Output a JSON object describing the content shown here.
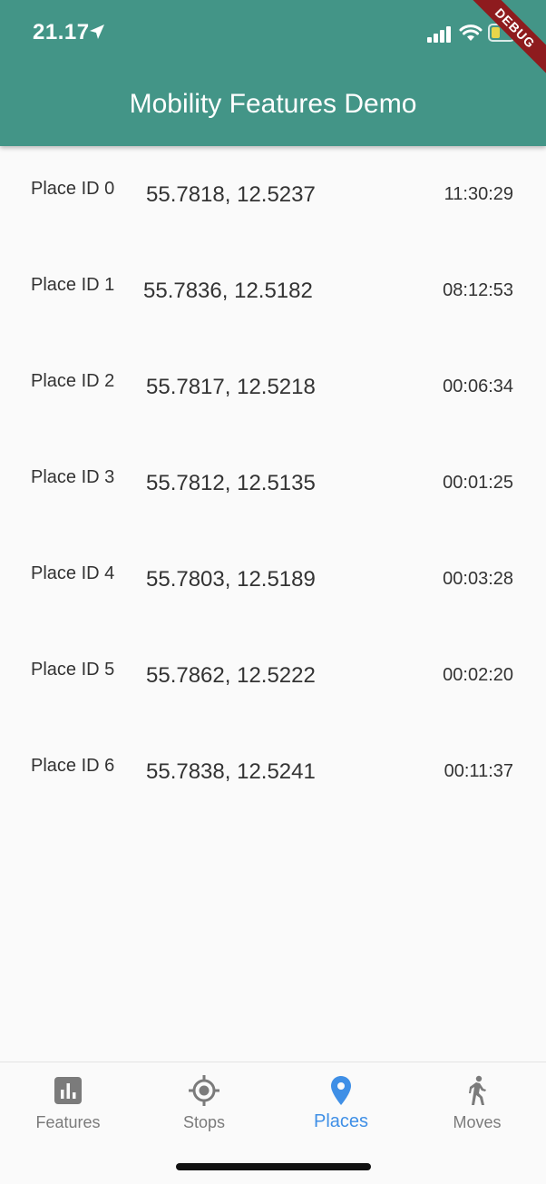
{
  "status_bar": {
    "time": "21.17",
    "icons": [
      "location-arrow-icon",
      "signal-icon",
      "wifi-icon",
      "battery-icon"
    ]
  },
  "debug_banner": "DEBUG",
  "app_bar": {
    "title": "Mobility Features Demo"
  },
  "places": [
    {
      "label": "Place ID 0",
      "coords": "55.7818, 12.5237",
      "duration": "11:30:29"
    },
    {
      "label": "Place ID 1",
      "coords": "55.7836, 12.5182",
      "duration": "08:12:53"
    },
    {
      "label": "Place ID 2",
      "coords": "55.7817, 12.5218",
      "duration": "00:06:34"
    },
    {
      "label": "Place ID 3",
      "coords": "55.7812, 12.5135",
      "duration": "00:01:25"
    },
    {
      "label": "Place ID 4",
      "coords": "55.7803, 12.5189",
      "duration": "00:03:28"
    },
    {
      "label": "Place ID 5",
      "coords": "55.7862, 12.5222",
      "duration": "00:02:20"
    },
    {
      "label": "Place ID 6",
      "coords": "55.7838, 12.5241",
      "duration": "00:11:37"
    }
  ],
  "bottom_nav": {
    "items": [
      {
        "label": "Features",
        "icon": "bar-chart-icon",
        "active": false
      },
      {
        "label": "Stops",
        "icon": "gps-target-icon",
        "active": false
      },
      {
        "label": "Places",
        "icon": "map-pin-icon",
        "active": true
      },
      {
        "label": "Moves",
        "icon": "walking-person-icon",
        "active": false
      }
    ]
  },
  "colors": {
    "app_bar": "#439587",
    "active_tab": "#3f8fe6",
    "inactive_tab": "#7b7b7b",
    "debug_ribbon": "#8e1b1e",
    "battery_level": "#e8d64a"
  }
}
